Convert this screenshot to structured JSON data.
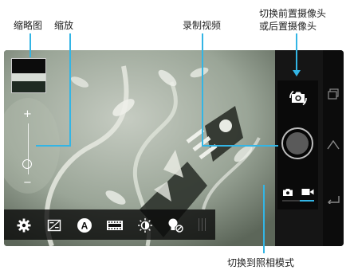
{
  "callouts": {
    "thumbnail": "缩略图",
    "zoom": "缩放",
    "record_video": "录制视频",
    "switch_camera_line1": "切换前置摄像头",
    "switch_camera_line2": "或后置摄像头",
    "switch_to_photo_mode": "切换到照相模式"
  },
  "viewfinder": {
    "zoom_plus_symbol": "+",
    "zoom_minus_symbol": "−",
    "zoom_level": 0.2
  },
  "bottom_toolbar": {
    "icons": [
      "gear-icon",
      "exposure-icon",
      "auto-mode-icon",
      "film-strip-icon",
      "white-balance-icon",
      "flash-off-icon"
    ]
  },
  "right_panel": {
    "icons": [
      "switch-camera-icon",
      "shutter-record-button",
      "camera-mode-icon",
      "video-mode-icon"
    ],
    "active_mode": "video"
  },
  "colors": {
    "accent": "#33b5e5",
    "callout_line": "#33b5e5",
    "bar_background": "#080808"
  }
}
